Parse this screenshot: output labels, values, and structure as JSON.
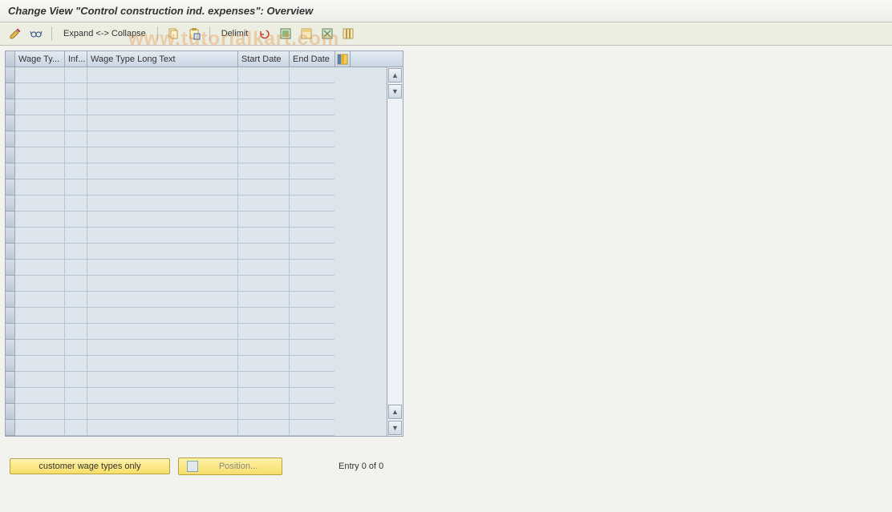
{
  "title": "Change View \"Control construction ind. expenses\": Overview",
  "toolbar": {
    "expand_collapse": "Expand <-> Collapse",
    "delimit": "Delimit"
  },
  "icons": {
    "pencil": "pencil-icon",
    "glasses": "display-icon",
    "copy": "copy-icon",
    "paste": "paste-icon",
    "undo": "undo-icon",
    "select_all": "select-all-icon",
    "select_block": "select-block-icon",
    "deselect": "deselect-icon",
    "config": "configure-columns-icon"
  },
  "table": {
    "headers": {
      "col1": "Wage Ty...",
      "col2": "Inf...",
      "col3": "Wage Type Long Text",
      "col4": "Start Date",
      "col5": "End Date"
    },
    "row_count": 23
  },
  "buttons": {
    "customer": "customer wage types only",
    "position": "Position..."
  },
  "status": "Entry 0 of 0",
  "watermark": "www.tutorialkart.com"
}
